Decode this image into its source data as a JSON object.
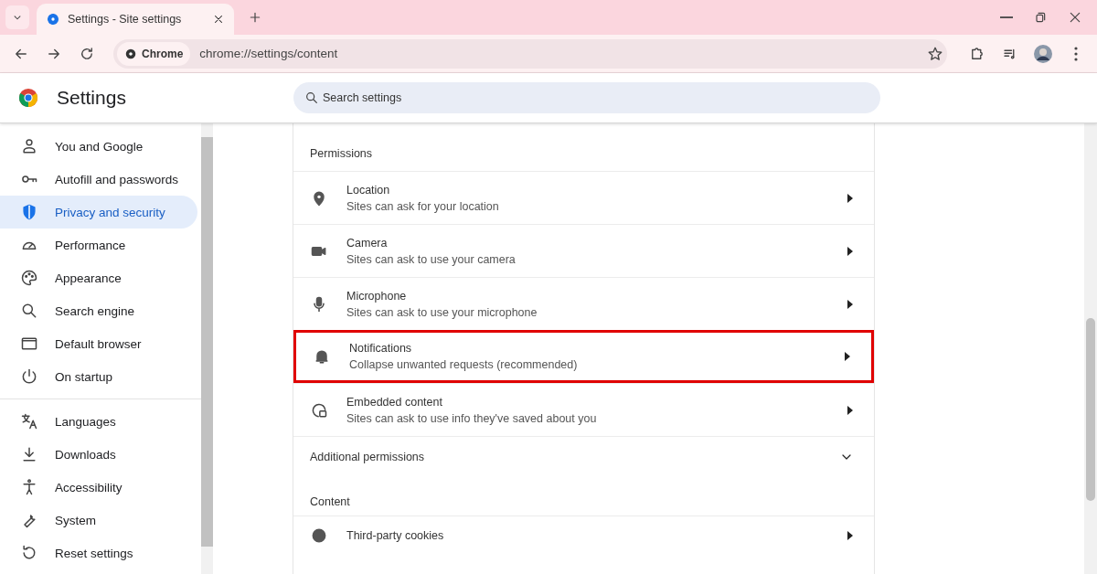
{
  "window": {
    "tabs": [
      {
        "title": "Settings - Site settings",
        "selected": true
      }
    ]
  },
  "address_bar": {
    "chip": "Chrome",
    "url": "chrome://settings/content"
  },
  "header": {
    "title": "Settings",
    "search": {
      "placeholder": "Search settings"
    }
  },
  "sidebar": {
    "groups": [
      {
        "items": [
          {
            "label": "You and Google",
            "selected": false
          },
          {
            "label": "Autofill and passwords",
            "selected": false
          },
          {
            "label": "Privacy and security",
            "selected": true
          },
          {
            "label": "Performance",
            "selected": false
          },
          {
            "label": "Appearance",
            "selected": false
          },
          {
            "label": "Search engine",
            "selected": false
          },
          {
            "label": "Default browser",
            "selected": false
          },
          {
            "label": "On startup",
            "selected": false
          }
        ]
      },
      {
        "items": [
          {
            "label": "Languages",
            "selected": false
          },
          {
            "label": "Downloads",
            "selected": false
          },
          {
            "label": "Accessibility",
            "selected": false
          },
          {
            "label": "System",
            "selected": false
          },
          {
            "label": "Reset settings",
            "selected": false
          }
        ]
      }
    ]
  },
  "permissions": {
    "heading": "Permissions",
    "rows": [
      {
        "title": "Location",
        "description": "Sites can ask for your location",
        "highlighted": false
      },
      {
        "title": "Camera",
        "description": "Sites can ask to use your camera",
        "highlighted": false
      },
      {
        "title": "Microphone",
        "description": "Sites can ask to use your microphone",
        "highlighted": false
      },
      {
        "title": "Notifications",
        "description": "Collapse unwanted requests (recommended)",
        "highlighted": true
      },
      {
        "title": "Embedded content",
        "description": "Sites can ask to use info they've saved about you",
        "highlighted": false
      }
    ]
  },
  "additional_permissions": {
    "label": "Additional permissions",
    "expanded": false
  },
  "content": {
    "heading": "Content",
    "rows": [
      {
        "title": "Third-party cookies"
      }
    ]
  }
}
